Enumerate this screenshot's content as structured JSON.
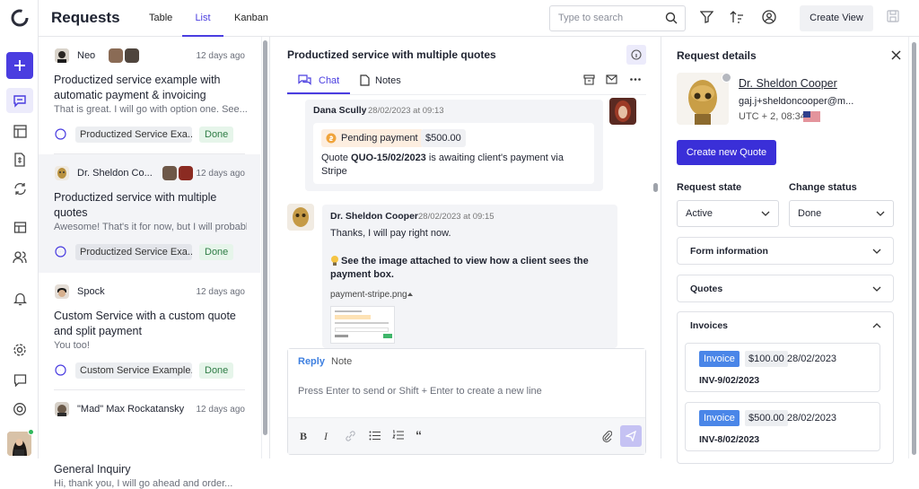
{
  "header": {
    "title": "Requests",
    "tabs": [
      "Table",
      "List",
      "Kanban"
    ],
    "active_tab": "List",
    "search_placeholder": "Type to search",
    "create_view_label": "Create View"
  },
  "list": {
    "items": [
      {
        "sender": "Neo",
        "time": "12 days ago",
        "title": "Productized service example with automatic payment & invoicing",
        "preview": "That is great. I will go with option one. See...",
        "service": "Productized Service Exa...",
        "status": "Done"
      },
      {
        "sender": "Dr. Sheldon Co...",
        "time": "12 days ago",
        "title": "Productized service with multiple quotes",
        "preview": "Awesome! That's it for now, but I will probabl...",
        "service": "Productized Service Exa...",
        "status": "Done"
      },
      {
        "sender": "Spock",
        "time": "12 days ago",
        "title": "Custom Service with a custom quote and split payment",
        "preview": "You too!",
        "service": "Custom Service Example...",
        "status": "Done"
      },
      {
        "sender": "\"Mad\" Max Rockatansky",
        "time": "12 days ago",
        "title": "General Inquiry",
        "preview": "Hi, thank you, I will go ahead and order..."
      }
    ]
  },
  "conversation": {
    "title": "Productized service with multiple quotes",
    "tabs": [
      "Chat",
      "Notes"
    ],
    "msg1": {
      "author": "Dana Scully",
      "time": "28/02/2023 at 09:13",
      "payment_label": "Pending payment",
      "payment_amount": "$500.00",
      "text_a": "Quote",
      "quote_id": "QUO-15/02/2023",
      "text_b": "is awaiting client's payment via",
      "text_c": "Stripe"
    },
    "msg2": {
      "author": "Dr. Sheldon Cooper",
      "time": "28/02/2023 at 09:15",
      "line1": "Thanks, I will pay right now.",
      "line2": "See the image attached to view how a client sees the",
      "line3": "payment box.",
      "attachment": "payment-stripe.png"
    },
    "composer": {
      "reply_label": "Reply",
      "note_label": "Note",
      "placeholder": "Press Enter to send or Shift + Enter to create a new line"
    }
  },
  "details": {
    "heading": "Request details",
    "name": "Dr. Sheldon Cooper",
    "email": "gaj.j+sheldoncooper@m...",
    "timezone": "UTC + 2, 08:34",
    "create_quote_label": "Create new Quote",
    "request_state_label": "Request state",
    "request_state_value": "Active",
    "change_status_label": "Change status",
    "change_status_value": "Done",
    "sections": [
      "Form information",
      "Quotes",
      "Invoices"
    ],
    "invoices": [
      {
        "badge": "Invoice",
        "amount": "$100.00",
        "date": "28/02/2023",
        "number": "INV-9/02/2023"
      },
      {
        "badge": "Invoice",
        "amount": "$500.00",
        "date": "28/02/2023",
        "number": "INV-8/02/2023"
      }
    ]
  },
  "colors": {
    "accent": "#4a3de0",
    "done_bg": "#e6f5ea",
    "invoice_badge": "#4a86e8",
    "pending_bg": "#fdeee0"
  }
}
